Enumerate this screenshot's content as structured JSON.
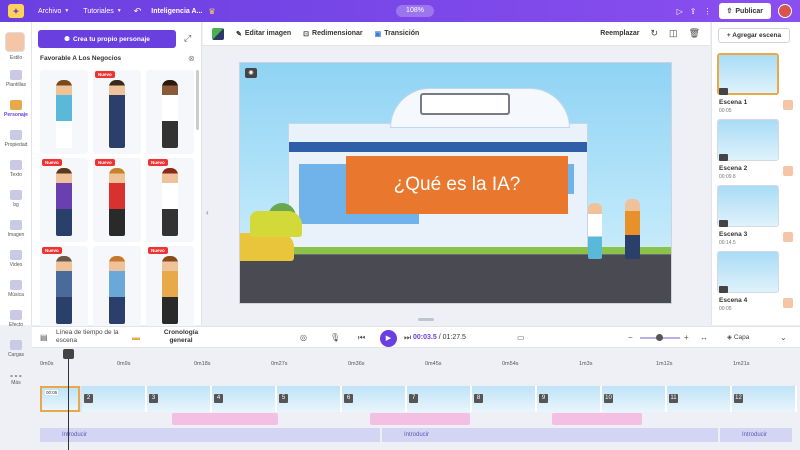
{
  "topbar": {
    "menu": [
      {
        "label": "Archivo"
      },
      {
        "label": "Tutoriales"
      }
    ],
    "project_name": "Inteligencia A...",
    "zoom": "108%",
    "publish_label": "Publicar"
  },
  "rail": {
    "items": [
      {
        "label": "Estilo"
      },
      {
        "label": "Plantillas"
      },
      {
        "label": "Personaje"
      },
      {
        "label": "Propiedad"
      },
      {
        "label": "Texto"
      },
      {
        "label": "bg"
      },
      {
        "label": "Imagen"
      },
      {
        "label": "Video"
      },
      {
        "label": "Música"
      },
      {
        "label": "Efecto"
      },
      {
        "label": "Cargas"
      },
      {
        "label": "Más"
      }
    ],
    "active": "Personaje"
  },
  "panel": {
    "create_label": "Crea tu propio personaje",
    "section_title": "Favorable A Los Negocios",
    "badge_text": "Nuevo",
    "characters": [
      {
        "badge": false,
        "skin": "#f0c29a",
        "hair": "#7a4a1d",
        "top": "#5ab8d8",
        "bottom": "#ffffff"
      },
      {
        "badge": true,
        "skin": "#f0c29a",
        "hair": "#3a2a1a",
        "top": "#2a3f6a",
        "bottom": "#2a3f6a"
      },
      {
        "badge": false,
        "skin": "#8a5a3a",
        "hair": "#2a1a0a",
        "top": "#ffffff",
        "bottom": "#333333"
      },
      {
        "badge": true,
        "skin": "#f0c29a",
        "hair": "#5a3a1a",
        "top": "#6a3fb0",
        "bottom": "#2a3f6a"
      },
      {
        "badge": true,
        "skin": "#f0c29a",
        "hair": "#c4852a",
        "top": "#d93030",
        "bottom": "#2a2a2a"
      },
      {
        "badge": true,
        "skin": "#f0c29a",
        "hair": "#8a2a1a",
        "top": "#ffffff",
        "bottom": "#333333"
      },
      {
        "badge": true,
        "skin": "#f0c29a",
        "hair": "#6a5a4a",
        "top": "#4a6a9a",
        "bottom": "#2a3f6a"
      },
      {
        "badge": false,
        "skin": "#f0c29a",
        "hair": "#c47a2a",
        "top": "#6aa8d8",
        "bottom": "#2a3f6a"
      },
      {
        "badge": true,
        "skin": "#f0c29a",
        "hair": "#8a4a1a",
        "top": "#e8a94a",
        "bottom": "#2a2a2a"
      }
    ]
  },
  "toolbar": {
    "edit_image": "Editar imagen",
    "resize": "Redimensionar",
    "transition": "Transición",
    "replace": "Reemplazar"
  },
  "canvas": {
    "title": "¿Qué es la IA?"
  },
  "scenes": {
    "add_label": "+ Agregar escena",
    "items": [
      {
        "label": "Escena 1",
        "duration": "00:05"
      },
      {
        "label": "Escena 2",
        "duration": "00:09.8"
      },
      {
        "label": "Escena 3",
        "duration": "00:14.5"
      },
      {
        "label": "Escena 4",
        "duration": "00:05"
      }
    ]
  },
  "timeline": {
    "scene_timeline_label": "Línea de tiempo de la escena",
    "general_label": "Cronología general",
    "current_time": "00:03.5",
    "total_time": "01:27.5",
    "layer_label": "Capa",
    "ruler": [
      "0m0s",
      "0m9s",
      "0m18s",
      "0m27s",
      "0m36s",
      "0m45s",
      "0m54s",
      "1m3s",
      "1m12s",
      "1m21s"
    ],
    "first_clip_time": "00:05",
    "clips": [
      {
        "num": "2"
      },
      {
        "num": "3"
      },
      {
        "num": "4"
      },
      {
        "num": "5"
      },
      {
        "num": "6"
      },
      {
        "num": "7"
      },
      {
        "num": "8"
      },
      {
        "num": "9"
      },
      {
        "num": "10"
      },
      {
        "num": "11"
      },
      {
        "num": "12"
      }
    ],
    "lilac_labels": [
      "Introducir",
      "Introducir",
      "Introducir"
    ]
  },
  "colors": {
    "accent": "#6a3fe0",
    "highlight": "#e8a94a",
    "title_box": "#e9772e"
  }
}
